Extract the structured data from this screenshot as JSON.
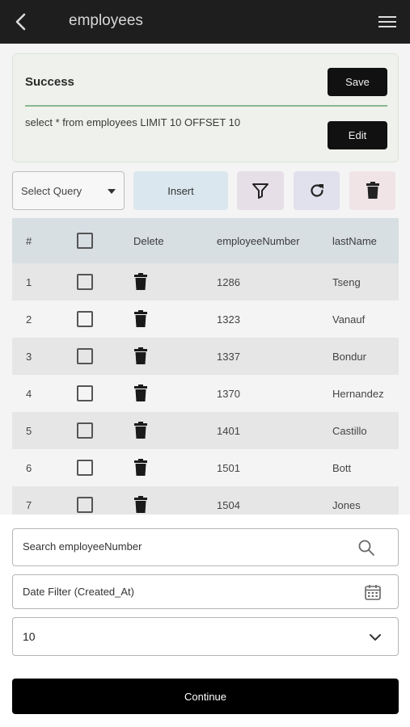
{
  "appbar": {
    "title": "employees",
    "back_icon": "arrow-back-icon",
    "menu_icon": "hamburger-menu-icon"
  },
  "status": {
    "title": "Success",
    "save_label": "Save",
    "query": "select * from employees LIMIT 10 OFFSET 10",
    "edit_label": "Edit",
    "accent_color": "#8bb88f"
  },
  "toolbar": {
    "select_query_label": "Select Query",
    "insert_label": "Insert",
    "filter_icon": "filter-icon",
    "refresh_icon": "refresh-icon",
    "delete_icon": "trash-icon"
  },
  "table": {
    "headers": [
      "#",
      "",
      "Delete",
      "employeeNumber",
      "lastName"
    ],
    "rows": [
      {
        "num": "1",
        "employeeNumber": "1286",
        "lastName": "Tseng"
      },
      {
        "num": "2",
        "employeeNumber": "1323",
        "lastName": "Vanauf"
      },
      {
        "num": "3",
        "employeeNumber": "1337",
        "lastName": "Bondur"
      },
      {
        "num": "4",
        "employeeNumber": "1370",
        "lastName": "Hernandez"
      },
      {
        "num": "5",
        "employeeNumber": "1401",
        "lastName": "Castillo"
      },
      {
        "num": "6",
        "employeeNumber": "1501",
        "lastName": "Bott"
      },
      {
        "num": "7",
        "employeeNumber": "1504",
        "lastName": "Jones"
      }
    ]
  },
  "sheet": {
    "search_placeholder": "Search employeeNumber",
    "date_filter_placeholder": "Date Filter (Created_At)",
    "limit_value": "10",
    "continue_label": "Continue"
  }
}
